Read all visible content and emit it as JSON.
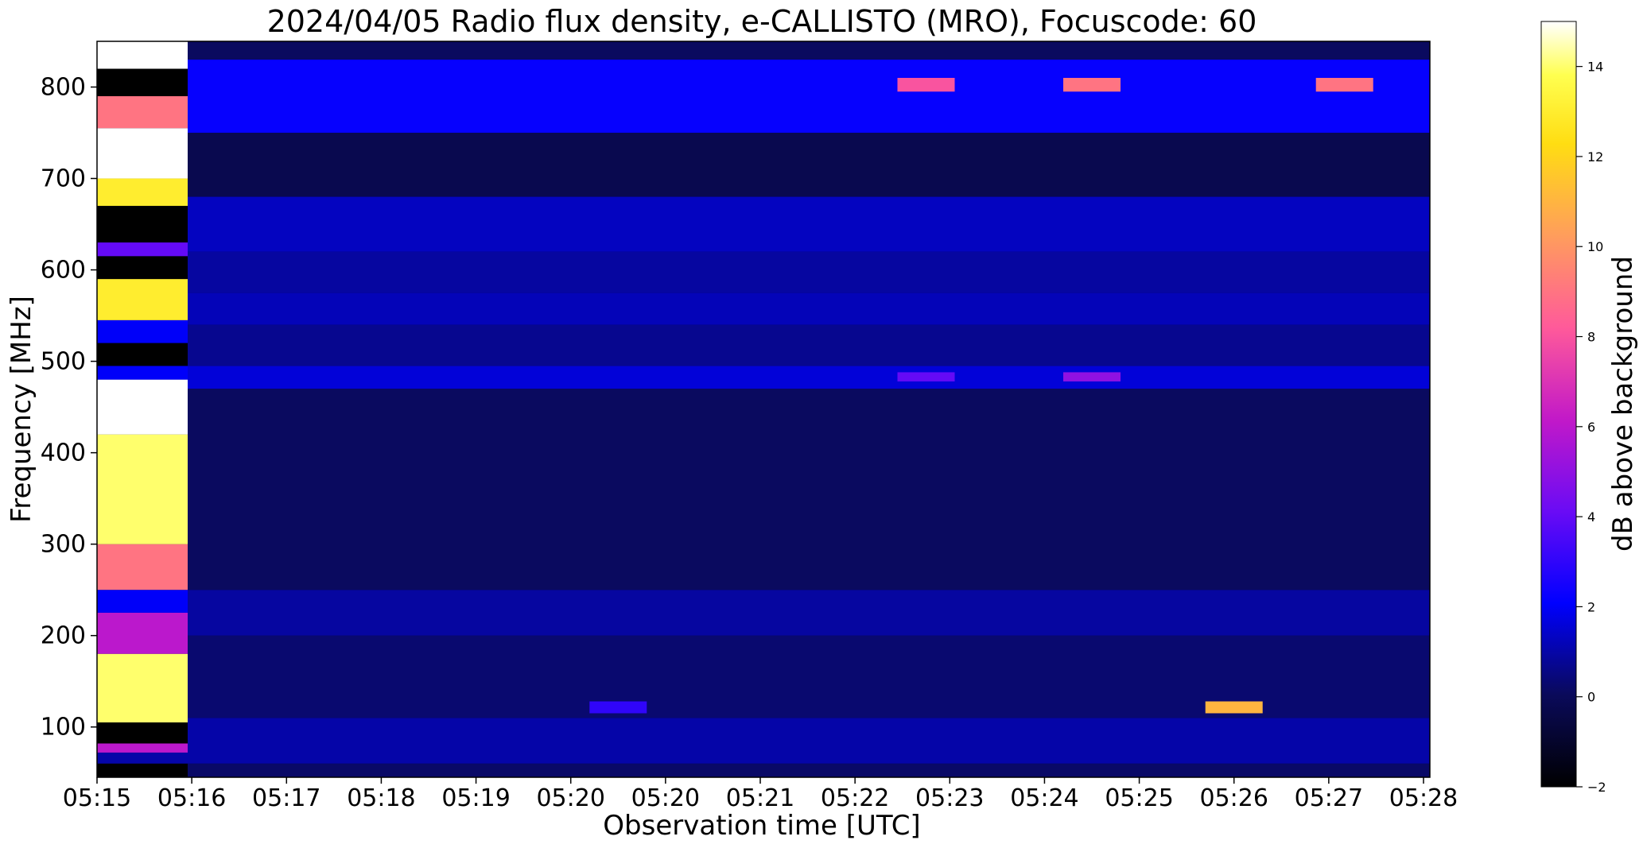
{
  "chart_data": {
    "type": "heatmap",
    "title": "2024/04/05  Radio flux density, e-CALLISTO (MRO), Focuscode: 60",
    "xlabel": "Observation time [UTC]",
    "ylabel": "Frequency [MHz]",
    "x_tick_labels": [
      "05:15",
      "05:16",
      "05:17",
      "05:18",
      "05:19",
      "05:20",
      "05:20",
      "05:21",
      "05:22",
      "05:23",
      "05:24",
      "05:25",
      "05:26",
      "05:27",
      "05:28"
    ],
    "ylim": [
      45,
      850
    ],
    "y_ticks": [
      100,
      200,
      300,
      400,
      500,
      600,
      700,
      800
    ],
    "colorbar": {
      "label": "dB above background",
      "range": [
        -2,
        15
      ],
      "ticks": [
        -2,
        0,
        2,
        4,
        6,
        8,
        10,
        12,
        14
      ],
      "colormap": "gnuplot2"
    },
    "calibration_stripe": {
      "time_range": [
        "05:15",
        "05:16"
      ],
      "bands": [
        {
          "from": 45,
          "to": 60,
          "db": -2
        },
        {
          "from": 60,
          "to": 72,
          "db": 1
        },
        {
          "from": 72,
          "to": 82,
          "db": 6
        },
        {
          "from": 82,
          "to": 105,
          "db": -2
        },
        {
          "from": 105,
          "to": 180,
          "db": 14
        },
        {
          "from": 180,
          "to": 225,
          "db": 6
        },
        {
          "from": 225,
          "to": 250,
          "db": 2
        },
        {
          "from": 250,
          "to": 300,
          "db": 9
        },
        {
          "from": 300,
          "to": 420,
          "db": 14
        },
        {
          "from": 420,
          "to": 480,
          "db": 15
        },
        {
          "from": 480,
          "to": 495,
          "db": 2
        },
        {
          "from": 495,
          "to": 520,
          "db": -2
        },
        {
          "from": 520,
          "to": 545,
          "db": 2
        },
        {
          "from": 545,
          "to": 590,
          "db": 13
        },
        {
          "from": 590,
          "to": 615,
          "db": -2
        },
        {
          "from": 615,
          "to": 630,
          "db": 4
        },
        {
          "from": 630,
          "to": 670,
          "db": -2
        },
        {
          "from": 670,
          "to": 700,
          "db": 13
        },
        {
          "from": 700,
          "to": 755,
          "db": 15
        },
        {
          "from": 755,
          "to": 790,
          "db": 9
        },
        {
          "from": 790,
          "to": 820,
          "db": -2
        },
        {
          "from": 820,
          "to": 850,
          "db": 15
        }
      ]
    },
    "background_bands": [
      {
        "from": 45,
        "to": 60,
        "db": 0.2
      },
      {
        "from": 60,
        "to": 110,
        "db": 1.0
      },
      {
        "from": 110,
        "to": 200,
        "db": 0.3
      },
      {
        "from": 200,
        "to": 250,
        "db": 0.9
      },
      {
        "from": 250,
        "to": 470,
        "db": 0.1
      },
      {
        "from": 470,
        "to": 495,
        "db": 1.6
      },
      {
        "from": 495,
        "to": 540,
        "db": 0.7
      },
      {
        "from": 540,
        "to": 575,
        "db": 1.2
      },
      {
        "from": 575,
        "to": 620,
        "db": 0.9
      },
      {
        "from": 620,
        "to": 680,
        "db": 1.3
      },
      {
        "from": 680,
        "to": 750,
        "db": -0.2
      },
      {
        "from": 750,
        "to": 830,
        "db": 2.2
      },
      {
        "from": 830,
        "to": 850,
        "db": 0.1
      }
    ],
    "bursts": [
      {
        "time": "05:23:45",
        "freq_from": 795,
        "freq_to": 810,
        "db": 8
      },
      {
        "time": "05:25:30",
        "freq_from": 795,
        "freq_to": 810,
        "db": 9
      },
      {
        "time": "05:28:10",
        "freq_from": 795,
        "freq_to": 810,
        "db": 9
      },
      {
        "time": "05:27:00",
        "freq_from": 115,
        "freq_to": 128,
        "db": 11
      },
      {
        "time": "05:20:30",
        "freq_from": 115,
        "freq_to": 128,
        "db": 3
      },
      {
        "time": "05:25:30",
        "freq_from": 478,
        "freq_to": 488,
        "db": 5
      },
      {
        "time": "05:23:45",
        "freq_from": 478,
        "freq_to": 488,
        "db": 4
      }
    ]
  }
}
